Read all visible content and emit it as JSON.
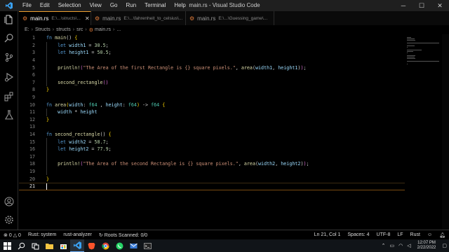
{
  "window": {
    "title": "main.rs - Visual Studio Code",
    "controls": {
      "minimize": "─",
      "maximize": "☐",
      "close": "✕"
    }
  },
  "menu": [
    "File",
    "Edit",
    "Selection",
    "View",
    "Go",
    "Run",
    "Terminal",
    "Help"
  ],
  "activity_icons": [
    "files-icon",
    "search-icon",
    "source-control-icon",
    "run-debug-icon",
    "extensions-icon",
    "testing-icon",
    "account-icon",
    "settings-gear-icon"
  ],
  "tabs": [
    {
      "name": "main.rs",
      "path": "E:\\...\\structs\\...",
      "active": true
    },
    {
      "name": "main.rs",
      "path": "E:\\...\\fahrenheit_to_celsius\\...",
      "active": false
    },
    {
      "name": "main.rs",
      "path": "E:\\...\\Guessing_game\\...",
      "active": false
    }
  ],
  "breadcrumb": [
    "E:",
    "Structs",
    "structs",
    "src",
    "main.rs",
    "..."
  ],
  "editor": {
    "current_line": 21,
    "lines": [
      [
        {
          "t": "fn ",
          "c": "kw"
        },
        {
          "t": "main",
          "c": "fn"
        },
        {
          "t": "() ",
          "c": ""
        },
        {
          "t": "{",
          "c": "br1"
        }
      ],
      [
        {
          "t": "    let ",
          "c": "kw"
        },
        {
          "t": "width1",
          "c": "var"
        },
        {
          "t": " = ",
          "c": ""
        },
        {
          "t": "30.5",
          "c": "num"
        },
        {
          "t": ";",
          "c": ""
        }
      ],
      [
        {
          "t": "    let ",
          "c": "kw"
        },
        {
          "t": "height1",
          "c": "var"
        },
        {
          "t": " = ",
          "c": ""
        },
        {
          "t": "50.5",
          "c": "num"
        },
        {
          "t": ";",
          "c": ""
        }
      ],
      [],
      [
        {
          "t": "    println!",
          "c": "mac"
        },
        {
          "t": "(",
          "c": "br2"
        },
        {
          "t": "\"The Area of the first Rectangle is {} square pixels.\"",
          "c": "str"
        },
        {
          "t": ", ",
          "c": ""
        },
        {
          "t": "area",
          "c": "fn"
        },
        {
          "t": "(",
          "c": ""
        },
        {
          "t": "width1",
          "c": "var"
        },
        {
          "t": ", ",
          "c": ""
        },
        {
          "t": "height1",
          "c": "var"
        },
        {
          "t": ")",
          "c": ""
        },
        {
          "t": ")",
          "c": "br2"
        },
        {
          "t": ";",
          "c": ""
        }
      ],
      [],
      [
        {
          "t": "    second_rectangle",
          "c": "fn"
        },
        {
          "t": "()",
          "c": "br2"
        }
      ],
      [
        {
          "t": "}",
          "c": "br1"
        }
      ],
      [],
      [
        {
          "t": "fn ",
          "c": "kw"
        },
        {
          "t": "area",
          "c": "fn"
        },
        {
          "t": "(",
          "c": "br1"
        },
        {
          "t": "width",
          "c": "var"
        },
        {
          "t": ": ",
          "c": ""
        },
        {
          "t": "f64",
          "c": "ty"
        },
        {
          "t": " , ",
          "c": ""
        },
        {
          "t": "height",
          "c": "var"
        },
        {
          "t": ": ",
          "c": ""
        },
        {
          "t": "f64",
          "c": "ty"
        },
        {
          "t": ")",
          "c": "br1"
        },
        {
          "t": " -> ",
          "c": ""
        },
        {
          "t": "f64",
          "c": "ty"
        },
        {
          "t": " ",
          "c": ""
        },
        {
          "t": "{",
          "c": "br1"
        }
      ],
      [
        {
          "t": "    width",
          "c": "var"
        },
        {
          "t": " * ",
          "c": ""
        },
        {
          "t": "height",
          "c": "var"
        }
      ],
      [
        {
          "t": "}",
          "c": "br1"
        }
      ],
      [],
      [
        {
          "t": "fn ",
          "c": "kw"
        },
        {
          "t": "second_rectangle",
          "c": "fn"
        },
        {
          "t": "() ",
          "c": ""
        },
        {
          "t": "{",
          "c": "br1"
        }
      ],
      [
        {
          "t": "    let ",
          "c": "kw"
        },
        {
          "t": "width2",
          "c": "var"
        },
        {
          "t": " = ",
          "c": ""
        },
        {
          "t": "58.7",
          "c": "num"
        },
        {
          "t": ";",
          "c": ""
        }
      ],
      [
        {
          "t": "    let ",
          "c": "kw"
        },
        {
          "t": "height2",
          "c": "var"
        },
        {
          "t": " = ",
          "c": ""
        },
        {
          "t": "77.9",
          "c": "num"
        },
        {
          "t": ";",
          "c": ""
        }
      ],
      [],
      [
        {
          "t": "    println!",
          "c": "mac"
        },
        {
          "t": "(",
          "c": "br2"
        },
        {
          "t": "\"The Area of the second Rectangle is {} square pixels.\"",
          "c": "str"
        },
        {
          "t": ", ",
          "c": ""
        },
        {
          "t": "area",
          "c": "fn"
        },
        {
          "t": "(",
          "c": ""
        },
        {
          "t": "width2",
          "c": "var"
        },
        {
          "t": ", ",
          "c": ""
        },
        {
          "t": "height2",
          "c": "var"
        },
        {
          "t": ")",
          "c": ""
        },
        {
          "t": ")",
          "c": "br2"
        },
        {
          "t": ";",
          "c": ""
        }
      ],
      [],
      [
        {
          "t": "}",
          "c": "br1"
        }
      ],
      []
    ]
  },
  "status": {
    "errors": "0",
    "warnings": "0",
    "left": [
      "Rust: system",
      "rust-analyzer",
      "Roots Scanned: 0/0"
    ],
    "right": [
      "Ln 21, Col 1",
      "Spaces: 4",
      "UTF-8",
      "LF",
      "Rust"
    ]
  },
  "taskbar": {
    "icons": [
      "windows-start-icon",
      "search-icon",
      "task-view-icon",
      "file-explorer-icon",
      "store-icon",
      "vscode-icon",
      "brave-browser-icon",
      "chrome-icon",
      "whatsapp-icon",
      "mail-icon",
      "terminal-icon"
    ],
    "active_icon": "vscode-icon",
    "time": "12:07 PM",
    "date": "2/22/2022"
  },
  "colors": {
    "accent": "#f0a030",
    "keyword": "#569cd6",
    "function": "#dcdcaa",
    "string": "#ce9178",
    "number": "#b5cea8",
    "type": "#4ec9b0",
    "variable": "#9cdcfe"
  }
}
